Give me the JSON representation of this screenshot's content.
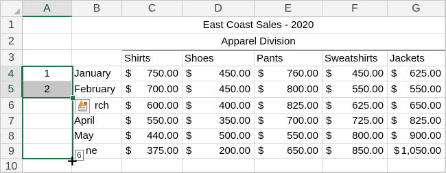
{
  "columns": [
    "A",
    "B",
    "C",
    "D",
    "E",
    "F",
    "G"
  ],
  "rows": [
    "1",
    "2",
    "3",
    "4",
    "5",
    "6",
    "7",
    "8",
    "9",
    "10"
  ],
  "title": "East Coast Sales - 2020",
  "subtitle": "Apparel Division",
  "categories": [
    "Shirts",
    "Shoes",
    "Pants",
    "Sweatshirts",
    "Jackets"
  ],
  "currency_symbol": "$",
  "column_a": [
    "1",
    "2"
  ],
  "months": [
    "January",
    "February",
    "rch",
    "April",
    "May",
    "ne"
  ],
  "sales": [
    [
      "750.00",
      "450.00",
      "760.00",
      "450.00",
      "625.00"
    ],
    [
      "700.00",
      "450.00",
      "800.00",
      "550.00",
      "550.00"
    ],
    [
      "600.00",
      "400.00",
      "825.00",
      "625.00",
      "650.00"
    ],
    [
      "550.00",
      "350.00",
      "700.00",
      "725.00",
      "825.00"
    ],
    [
      "440.00",
      "500.00",
      "550.00",
      "800.00",
      "900.00"
    ],
    [
      "375.00",
      "200.00",
      "650.00",
      "850.00",
      "1,050.00"
    ]
  ],
  "fill_tooltip": "6",
  "icons": {
    "smart_tag": "auto-fill-options-icon",
    "cursor": "fill-crosshair-cursor-icon"
  },
  "colors": {
    "selection": "#217346",
    "selected_cell": "#c6c6c6",
    "header_bg": "#f3f3f3"
  }
}
